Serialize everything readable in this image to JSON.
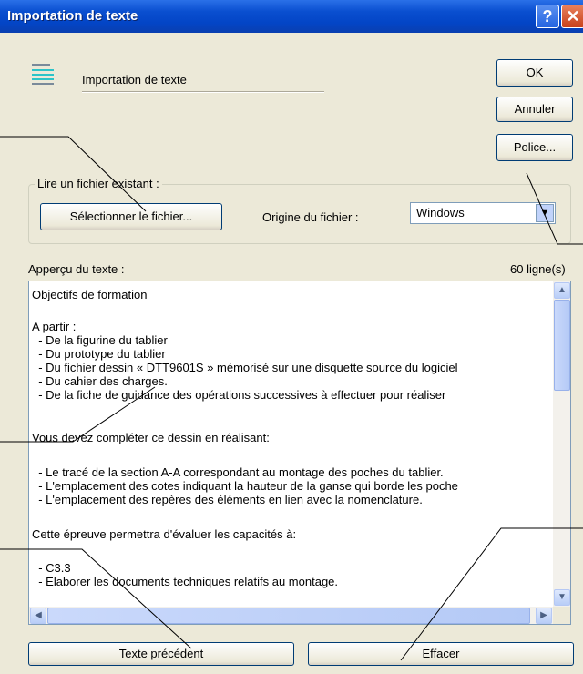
{
  "window": {
    "title": "Importation de texte",
    "help_glyph": "?",
    "close_glyph": "✕"
  },
  "header": {
    "icon": "text-document-icon",
    "label": "Importation de texte"
  },
  "buttons": {
    "ok": "OK",
    "cancel": "Annuler",
    "font": "Police..."
  },
  "existing_file": {
    "group_label": "Lire un fichier existant :",
    "select_button": "Sélectionner le fichier...",
    "origin_label": "Origine du fichier :",
    "origin_value": "Windows",
    "origin_arrow": "▼"
  },
  "preview": {
    "label": "Apperçu du texte :",
    "line_count": "60 ligne(s)",
    "lines": [
      "Objectifs de formation",
      "",
      "A partir :",
      "  - De la figurine du tablier",
      "  - Du prototype du tablier",
      "  - Du fichier dessin « DTT9601S » mémorisé sur une disquette source du logiciel",
      "  - Du cahier des charges.",
      "  - De la fiche de guidance des opérations successives à effectuer pour réaliser",
      "",
      "Vous devez compléter ce dessin en réalisant:",
      "",
      "  - Le tracé de la section A-A correspondant au montage des poches du tablier.",
      "  - L'emplacement des cotes indiquant la hauteur de la ganse qui borde les poche",
      "  - L'emplacement des repères des éléments en lien avec la nomenclature.",
      "",
      "Cette épreuve permettra d'évaluer les capacités à:",
      "",
      "  - C3.3",
      "  - Elaborer les documents techniques relatifs au montage."
    ],
    "scroll_up": "▲",
    "scroll_down": "▼",
    "scroll_left": "◀",
    "scroll_right": "▶"
  },
  "bottom": {
    "previous_text": "Texte précédent",
    "clear": "Effacer"
  },
  "colors": {
    "title_bar": "#0a4fd0",
    "dialog_bg": "#ece9d8",
    "callout_line": "#000000"
  }
}
